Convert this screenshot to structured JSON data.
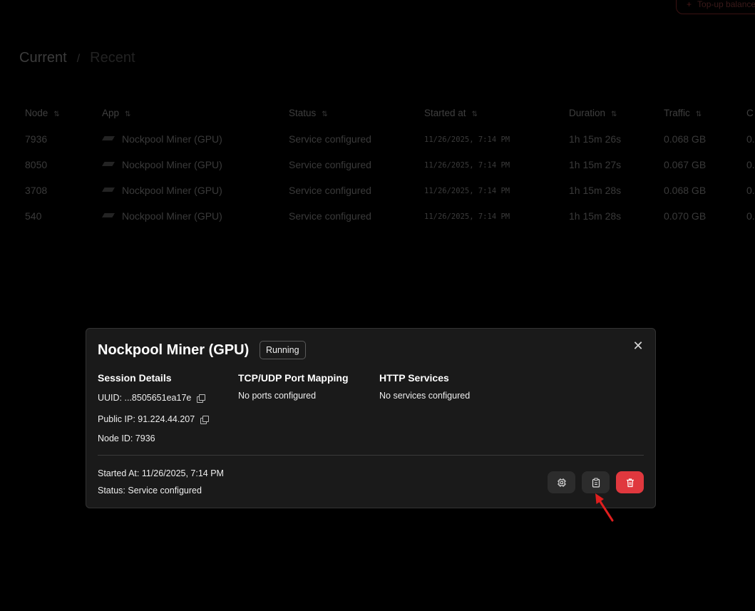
{
  "header": {
    "topup_label": "Top-up balance"
  },
  "tabs": {
    "current": "Current",
    "separator": "/",
    "recent": "Recent"
  },
  "table": {
    "columns": [
      "Node",
      "App",
      "Status",
      "Started at",
      "Duration",
      "Traffic",
      "C"
    ],
    "rows": [
      {
        "node": "7936",
        "app": "Nockpool Miner (GPU)",
        "status": "Service configured",
        "started": "11/26/2025, 7:14 PM",
        "duration": "1h 15m 26s",
        "traffic": "0.068 GB",
        "extra": "0."
      },
      {
        "node": "8050",
        "app": "Nockpool Miner (GPU)",
        "status": "Service configured",
        "started": "11/26/2025, 7:14 PM",
        "duration": "1h 15m 27s",
        "traffic": "0.067 GB",
        "extra": "0."
      },
      {
        "node": "3708",
        "app": "Nockpool Miner (GPU)",
        "status": "Service configured",
        "started": "11/26/2025, 7:14 PM",
        "duration": "1h 15m 28s",
        "traffic": "0.068 GB",
        "extra": "0."
      },
      {
        "node": "540",
        "app": "Nockpool Miner (GPU)",
        "status": "Service configured",
        "started": "11/26/2025, 7:14 PM",
        "duration": "1h 15m 28s",
        "traffic": "0.070 GB",
        "extra": "0."
      }
    ]
  },
  "modal": {
    "title": "Nockpool Miner (GPU)",
    "badge": "Running",
    "close_icon": "close-icon",
    "session": {
      "title": "Session Details",
      "uuid": "UUID: ...8505651ea17e",
      "public_ip": "Public IP: 91.224.44.207",
      "node_id": "Node ID: 7936"
    },
    "ports": {
      "title": "TCP/UDP Port Mapping",
      "empty": "No ports configured"
    },
    "http": {
      "title": "HTTP Services",
      "empty": "No services configured"
    },
    "footer": {
      "started": "Started At: 11/26/2025, 7:14 PM",
      "status": "Status: Service configured"
    },
    "actions": {
      "chip_icon": "cpu-chip-icon",
      "clipboard_icon": "clipboard-icon",
      "delete_icon": "trash-icon",
      "delete_color": "#e0383e"
    }
  }
}
